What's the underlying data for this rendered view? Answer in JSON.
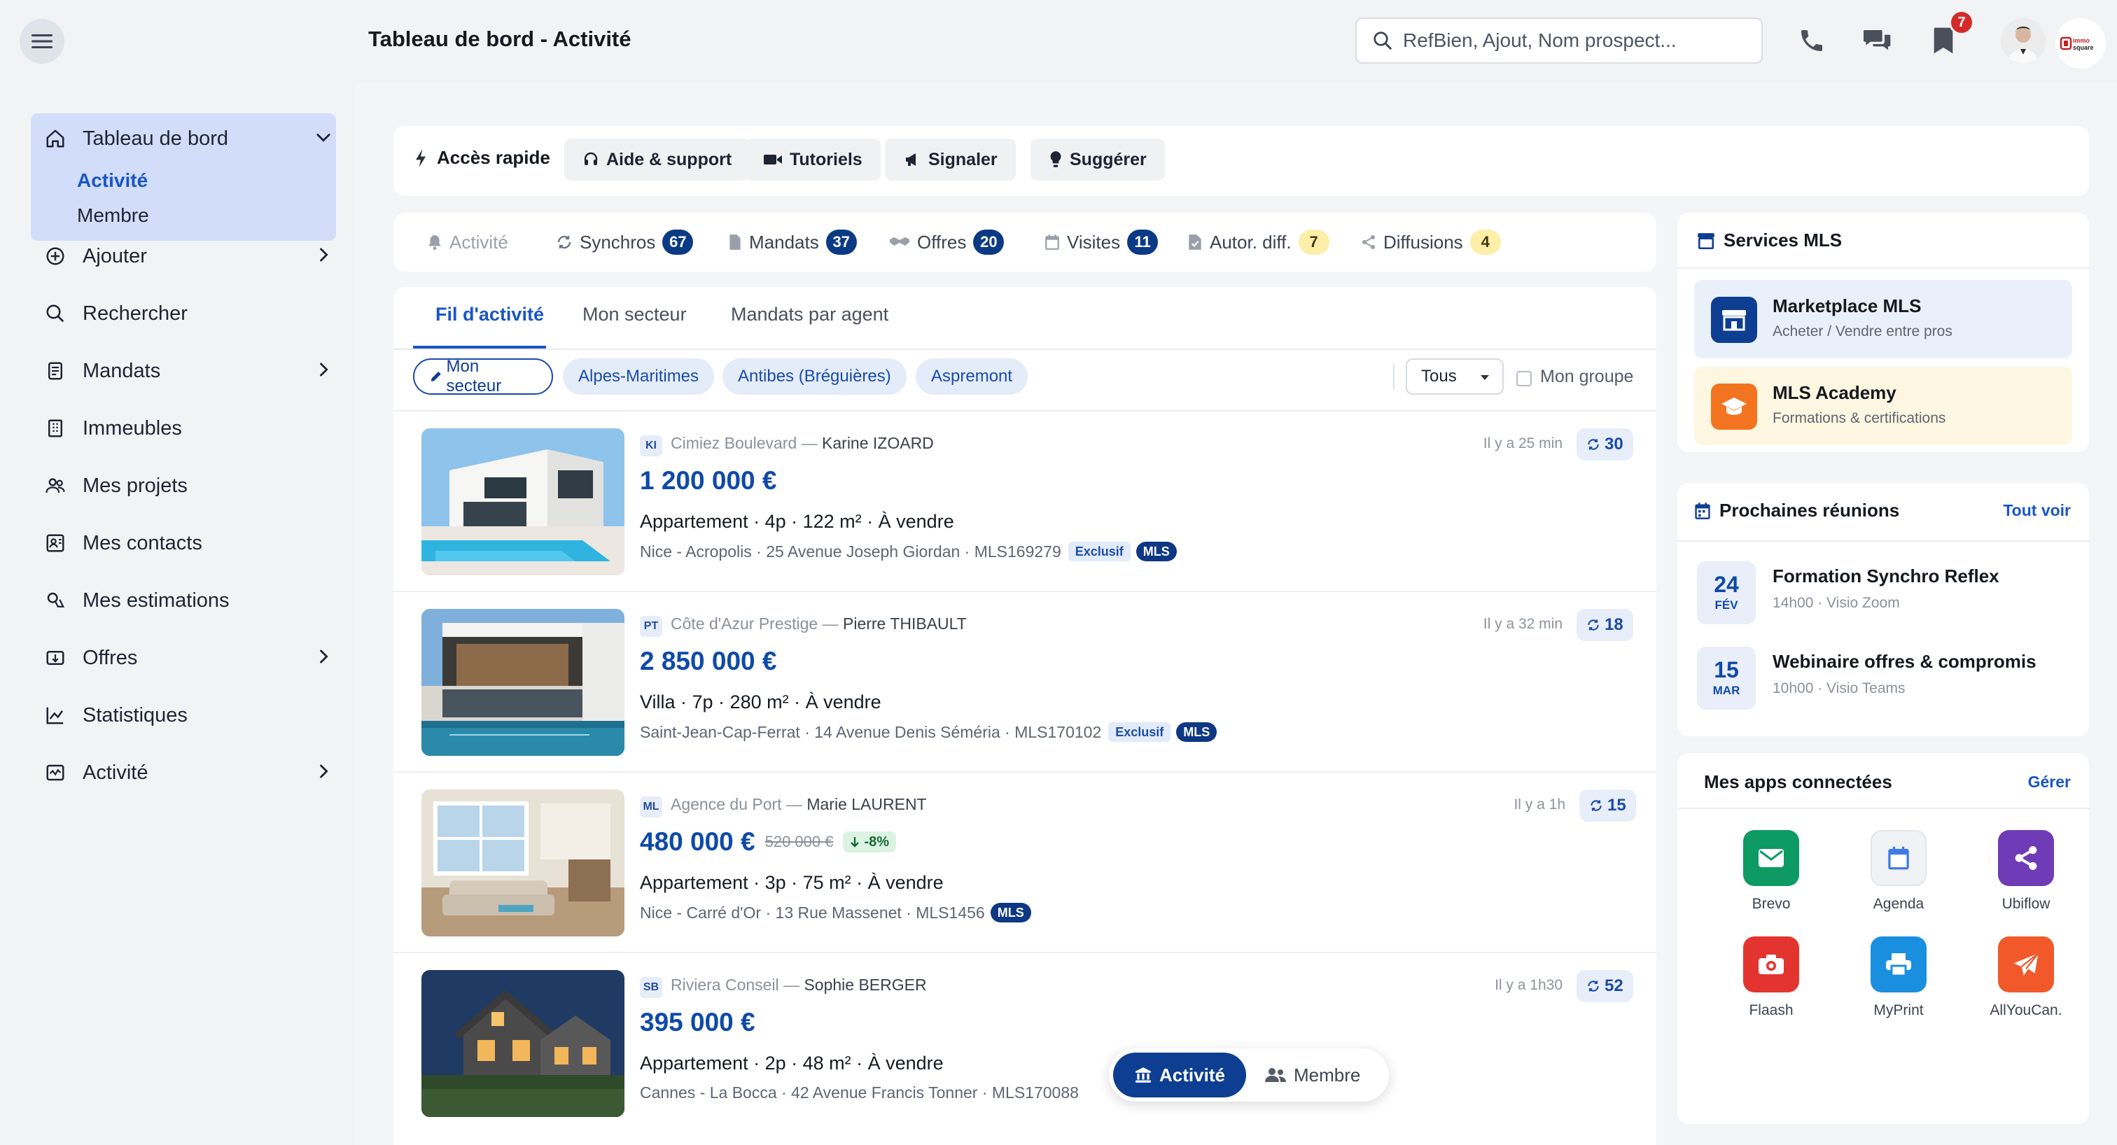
{
  "header": {
    "title": "Tableau de bord - Activité",
    "search_placeholder": "RefBien, Ajout, Nom prospect...",
    "notifications_count": "7",
    "brand_text": "immo square"
  },
  "sidebar": {
    "dashboard": {
      "label": "Tableau de bord",
      "sub": [
        "Activité",
        "Membre"
      ]
    },
    "items": [
      {
        "label": "Ajouter",
        "icon": "plus-circle-icon",
        "expandable": true
      },
      {
        "label": "Rechercher",
        "icon": "search-icon",
        "expandable": false
      },
      {
        "label": "Mandats",
        "icon": "document-icon",
        "expandable": true
      },
      {
        "label": "Immeubles",
        "icon": "building-icon",
        "expandable": false
      },
      {
        "label": "Mes projets",
        "icon": "people-icon",
        "expandable": false
      },
      {
        "label": "Mes contacts",
        "icon": "contact-card-icon",
        "expandable": false
      },
      {
        "label": "Mes estimations",
        "icon": "estimate-icon",
        "expandable": false
      },
      {
        "label": "Offres",
        "icon": "offer-icon",
        "expandable": true
      },
      {
        "label": "Statistiques",
        "icon": "chart-icon",
        "expandable": false
      },
      {
        "label": "Activité",
        "icon": "activity-icon",
        "expandable": true
      }
    ]
  },
  "quick_access": {
    "title": "Accès rapide",
    "buttons": [
      "Aide & support",
      "Tutoriels",
      "Signaler",
      "Suggérer"
    ]
  },
  "stats": [
    {
      "label": "Activité",
      "count": ""
    },
    {
      "label": "Synchros",
      "count": "67"
    },
    {
      "label": "Mandats",
      "count": "37"
    },
    {
      "label": "Offres",
      "count": "20"
    },
    {
      "label": "Visites",
      "count": "11"
    },
    {
      "label": "Autor. diff.",
      "count": "7"
    },
    {
      "label": "Diffusions",
      "count": "4"
    }
  ],
  "feed": {
    "tabs": [
      "Fil d'activité",
      "Mon secteur",
      "Mandats par agent"
    ],
    "chips": [
      "Mon secteur",
      "Alpes-Maritimes",
      "Antibes (Bréguières)",
      "Aspremont"
    ],
    "filter_select": "Tous",
    "group_label": "Mon groupe",
    "listings": [
      {
        "initials": "KI",
        "agency": "Cimiez Boulevard — ",
        "agent": "Karine IZOARD",
        "time": "Il y a 25 min",
        "sync": "30",
        "price": "1 200 000 €",
        "old_price": "",
        "drop": "",
        "desc": "Appartement · 4p · 122 m² · À vendre",
        "address": "Nice - Acropolis · 25 Avenue Joseph Giordan · MLS169279",
        "exclusive": "Exclusif",
        "mls": "MLS"
      },
      {
        "initials": "PT",
        "agency": "Côte d'Azur Prestige — ",
        "agent": "Pierre THIBAULT",
        "time": "Il y a 32 min",
        "sync": "18",
        "price": "2 850 000 €",
        "old_price": "",
        "drop": "",
        "desc": "Villa · 7p · 280 m² · À vendre",
        "address": "Saint-Jean-Cap-Ferrat · 14 Avenue Denis Séméria · MLS170102",
        "exclusive": "Exclusif",
        "mls": "MLS"
      },
      {
        "initials": "ML",
        "agency": "Agence du Port — ",
        "agent": "Marie LAURENT",
        "time": "Il y a 1h",
        "sync": "15",
        "price": "480 000 €",
        "old_price": "520 000 €",
        "drop": "-8%",
        "desc": "Appartement · 3p · 75 m² · À vendre",
        "address": "Nice - Carré d'Or · 13 Rue Massenet · MLS1456",
        "exclusive": "",
        "mls": "MLS"
      },
      {
        "initials": "SB",
        "agency": "Riviera Conseil — ",
        "agent": "Sophie BERGER",
        "time": "Il y a 1h30",
        "sync": "52",
        "price": "395 000 €",
        "old_price": "",
        "drop": "",
        "desc": "Appartement · 2p · 48 m² · À vendre",
        "address": "Cannes - La Bocca · 42 Avenue Francis Tonner · MLS170088",
        "exclusive": "",
        "mls": ""
      }
    ]
  },
  "view_toggle": {
    "active": "Activité",
    "other": "Membre"
  },
  "services_mls": {
    "title": "Services MLS",
    "items": [
      {
        "title": "Marketplace MLS",
        "subtitle": "Acheter / Vendre entre pros"
      },
      {
        "title": "MLS Academy",
        "subtitle": "Formations & certifications"
      }
    ]
  },
  "meetings": {
    "title": "Prochaines réunions",
    "link": "Tout voir",
    "items": [
      {
        "day": "24",
        "month": "FÉV",
        "title": "Formation Synchro Reflex",
        "subtitle": "14h00 · Visio Zoom"
      },
      {
        "day": "15",
        "month": "MAR",
        "title": "Webinaire offres & compromis",
        "subtitle": "10h00 · Visio Teams"
      }
    ]
  },
  "apps": {
    "title": "Mes apps connectées",
    "link": "Gérer",
    "items": [
      {
        "label": "Brevo",
        "color": "#0d9b63"
      },
      {
        "label": "Agenda",
        "color": "#f0f2f5"
      },
      {
        "label": "Ubiflow",
        "color": "#6f3bb6"
      },
      {
        "label": "Flaash",
        "color": "#e3342f"
      },
      {
        "label": "MyPrint",
        "color": "#1a8fe0"
      },
      {
        "label": "AllYouCan.",
        "color": "#f1592a"
      }
    ]
  },
  "colors": {
    "accent": "#0e4aa8",
    "navy": "#0d3e92",
    "sidebar_active": "#d2ddf9"
  }
}
